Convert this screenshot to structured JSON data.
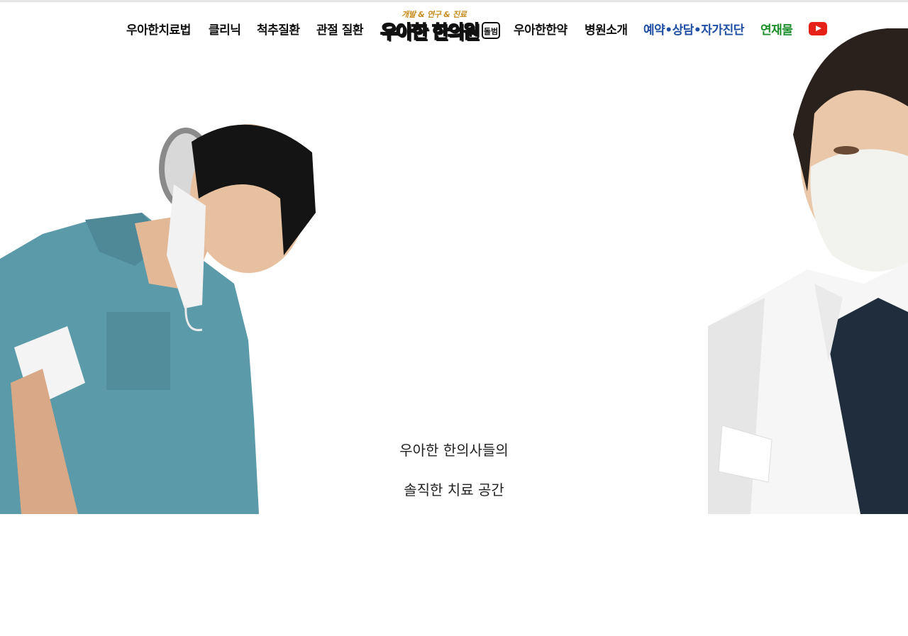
{
  "nav": {
    "items": [
      {
        "label": "우아한치료법"
      },
      {
        "label": "클리닉"
      },
      {
        "label": "척추질환"
      },
      {
        "label": "관절 질환"
      },
      {
        "label": "우아한한약"
      },
      {
        "label": "병원소개"
      },
      {
        "label": "예약•상담•자가진단"
      },
      {
        "label": "연재물"
      }
    ],
    "logo": {
      "subtitle": "개발 & 연구 & 진료",
      "title": "우아한 한의원",
      "badge": "돌범"
    },
    "youtube_icon": "youtube-icon"
  },
  "hero": {
    "line1": "우아한 한의사들의",
    "line2": "솔직한 치료 공간"
  },
  "colors": {
    "reservation": "#1f4fa3",
    "series": "#1d8f2b",
    "youtube": "#e62117",
    "scrubs": "#5b9aa8"
  }
}
